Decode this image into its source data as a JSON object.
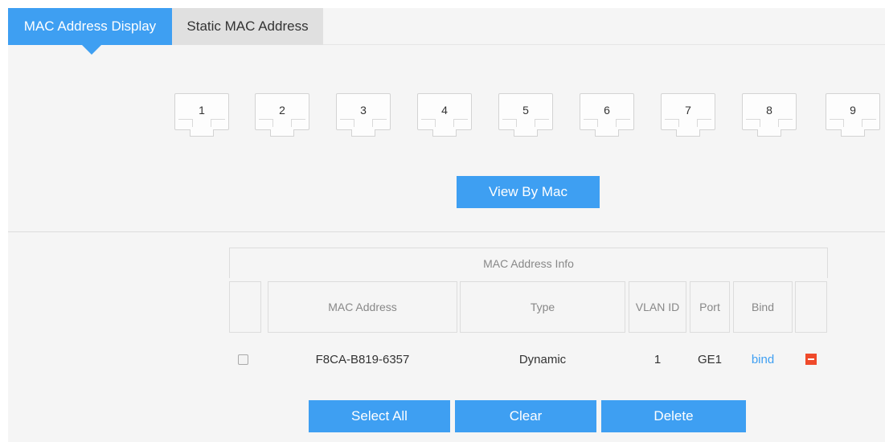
{
  "tabs": {
    "mac_display": "MAC Address Display",
    "static_mac": "Static MAC Address"
  },
  "ports": [
    "1",
    "2",
    "3",
    "4",
    "5",
    "6",
    "7",
    "8",
    "9"
  ],
  "view_button": "View By Mac",
  "table": {
    "title": "MAC Address Info",
    "headers": {
      "mac": "MAC Address",
      "type": "Type",
      "vlan": "VLAN ID",
      "port": "Port",
      "bind": "Bind"
    },
    "rows": [
      {
        "mac": "F8CA-B819-6357",
        "type": "Dynamic",
        "vlan": "1",
        "port": "GE1",
        "bind": "bind"
      }
    ]
  },
  "actions": {
    "select_all": "Select All",
    "clear": "Clear",
    "delete": "Delete"
  },
  "colors": {
    "accent": "#3e9ff2",
    "delete_icon": "#ef4a2b"
  }
}
